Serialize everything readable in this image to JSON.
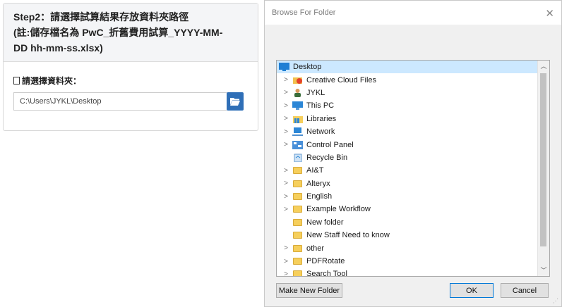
{
  "left_panel": {
    "step_title_line1": "Step2：請選擇試算結果存放資料夾路徑",
    "step_title_line2": "(註:儲存檔名為 PwC_折舊費用試算_YYYY-MM-",
    "step_title_line3": "DD hh-mm-ss.xlsx)",
    "folder_label": "請選擇資料夾：",
    "folder_path": "C:\\Users\\JYKL\\Desktop"
  },
  "dialog": {
    "title": "Browse For Folder",
    "root": "Desktop",
    "items": [
      {
        "label": "Creative Cloud Files",
        "icon": "creative-cloud-icon",
        "expandable": true
      },
      {
        "label": "JYKL",
        "icon": "user-icon",
        "expandable": true
      },
      {
        "label": "This PC",
        "icon": "computer-icon",
        "expandable": true
      },
      {
        "label": "Libraries",
        "icon": "libraries-icon",
        "expandable": true
      },
      {
        "label": "Network",
        "icon": "network-icon",
        "expandable": true
      },
      {
        "label": "Control Panel",
        "icon": "control-panel-icon",
        "expandable": true
      },
      {
        "label": "Recycle Bin",
        "icon": "recycle-bin-icon",
        "expandable": false
      },
      {
        "label": "AI&T",
        "icon": "folder-icon",
        "expandable": true
      },
      {
        "label": "Alteryx",
        "icon": "folder-icon",
        "expandable": true
      },
      {
        "label": "English",
        "icon": "folder-icon",
        "expandable": true
      },
      {
        "label": "Example Workflow",
        "icon": "folder-icon",
        "expandable": true
      },
      {
        "label": "New folder",
        "icon": "folder-icon",
        "expandable": false
      },
      {
        "label": "New Staff Need to know",
        "icon": "folder-icon",
        "expandable": false
      },
      {
        "label": "other",
        "icon": "folder-icon",
        "expandable": true
      },
      {
        "label": "PDFRotate",
        "icon": "folder-icon",
        "expandable": true
      },
      {
        "label": "Search Tool",
        "icon": "folder-icon",
        "expandable": true
      }
    ],
    "buttons": {
      "new_folder": "Make New Folder",
      "ok": "OK",
      "cancel": "Cancel"
    }
  }
}
